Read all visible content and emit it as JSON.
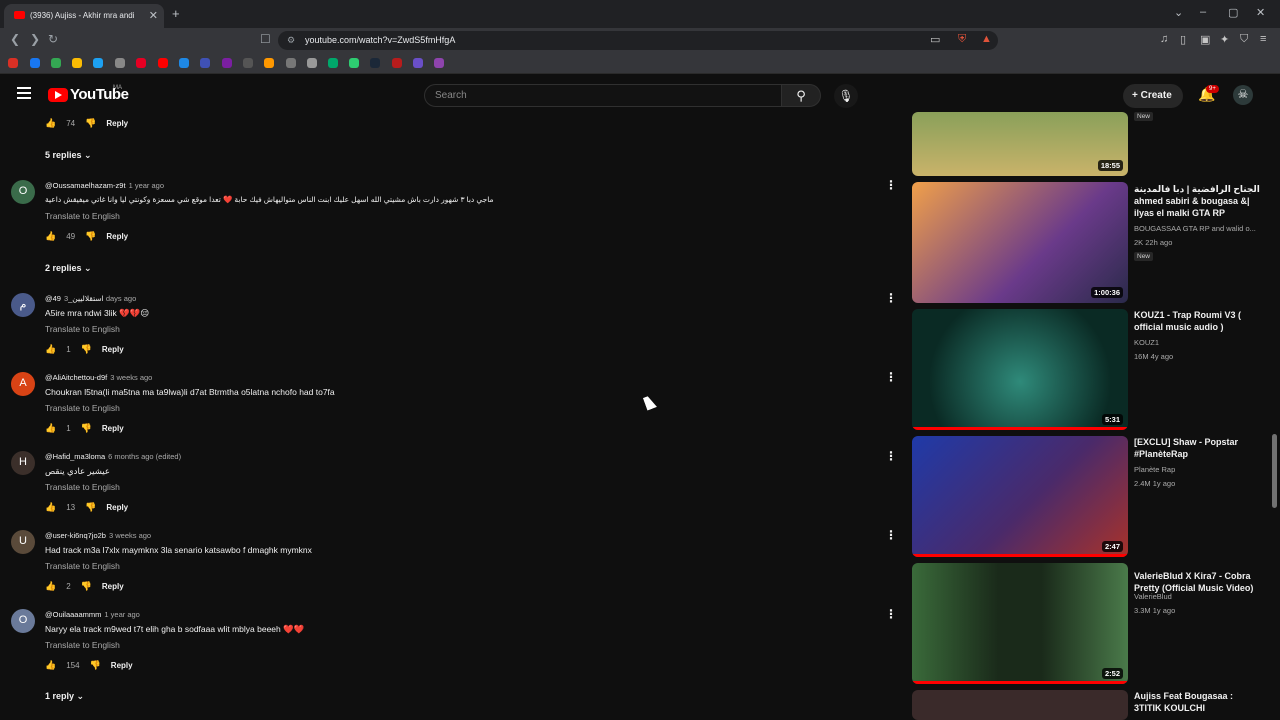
{
  "browser": {
    "tab_title": "(3936) Aujiss - Akhir mra andi",
    "url": "youtube.com/watch?v=ZwdS5fmHfgA"
  },
  "header": {
    "logo_text": "YouTube",
    "region": "MA",
    "search_placeholder": "Search",
    "create_label": "Create",
    "notif_badge": "9+"
  },
  "comments": [
    {
      "likes": "74",
      "reply_label": "Reply"
    },
    {
      "replies_label": "5 replies"
    },
    {
      "author": "@Oussamaelhazam-z9t",
      "time": "1 year ago",
      "text": "ماجي دبا ٣ شهور دارت باش مشيتي الله اسهل عليك ابنت الناس متواليهاش فيك حابة ❤️ تعدا موقع شي مسعزة وكونتي ليا وانا غاتي ميفيقش داعية",
      "translate": "Translate to English",
      "likes": "49",
      "reply_label": "Reply",
      "avatar_letter": "O",
      "avatar_color": "#3a6b4a"
    },
    {
      "replies_label": "2 replies"
    },
    {
      "author": "@استقلاليين_49",
      "time": "3 days ago",
      "text": "A5ire mra  ndwi 3lik 💔💔😔",
      "translate": "Translate to English",
      "likes": "1",
      "reply_label": "Reply",
      "avatar_letter": "م",
      "avatar_color": "#4a5a8a"
    },
    {
      "author": "@AliAitchettou-d9f",
      "time": "3 weeks ago",
      "text": "Choukran l5tna(li ma5tna ma ta9lwa)li d7at Btrmtha o5latna nchofo had to7fa",
      "translate": "Translate to English",
      "likes": "1",
      "reply_label": "Reply",
      "avatar_letter": "A",
      "avatar_color": "#d84315"
    },
    {
      "author": "@Hafid_ma3loma",
      "time": "6 months ago (edited)",
      "text": "عيشير  عادي ينقص",
      "translate": "Translate to English",
      "likes": "13",
      "reply_label": "Reply",
      "avatar_letter": "H",
      "avatar_color": "#3b2f2a"
    },
    {
      "author": "@user-ki6nq7jo2b",
      "time": "3 weeks ago",
      "text": "Had track m3a l7xlx maymknx 3la senario katsawbo f dmaghk mymknx",
      "translate": "Translate to English",
      "likes": "2",
      "reply_label": "Reply",
      "avatar_letter": "U",
      "avatar_color": "#5a4a3a"
    },
    {
      "author": "@Ouilaaaammm",
      "time": "1 year ago",
      "text": "Naryy ela track m9wed t7t elih gha b sodfaaa wlit mblya beeeh ❤️❤️",
      "translate": "Translate to English",
      "likes": "154",
      "reply_label": "Reply",
      "avatar_letter": "O",
      "avatar_color": "#6a7a9a"
    },
    {
      "replies_label": "1 reply"
    }
  ],
  "sidebar": {
    "videos": [
      {
        "duration": "18:55",
        "badge": "New",
        "thumb_color": "#6a8a4a"
      },
      {
        "title": "الجناح الرافضية | دبا فالمدينة ahmed sabiri & bougasa &| ilyas el malki GTA RP MARO...",
        "channel": "BOUGASSAA GTA RP and walid o...",
        "meta": "2K   22h ago",
        "badge": "New",
        "duration": "1:00:36",
        "thumb_color": "#c77a3a"
      },
      {
        "title": "KOUZ1 - Trap Roumi V3 ( official music audio )",
        "channel": "KOUZ1",
        "meta": "16M   4y ago",
        "duration": "5:31",
        "thumb_color": "#0f4a3f"
      },
      {
        "title": "[EXCLU] Shaw - Popstar #PlanèteRap",
        "channel": "Planète Rap",
        "meta": "2.4M   1y ago",
        "duration": "2:47",
        "thumb_color": "#2a3a8a"
      },
      {
        "title": "ValerieBlud X Kira7 - Cobra Pretty (Official Music Video)",
        "channel": "ValerieBlud",
        "meta": "3.3M   1y ago",
        "duration": "2:52",
        "thumb_color": "#1f3a24"
      },
      {
        "title": "Aujiss Feat Bougasaa : 3TITIK KOULCHI",
        "thumb_color": "#3a2a2a"
      }
    ]
  }
}
